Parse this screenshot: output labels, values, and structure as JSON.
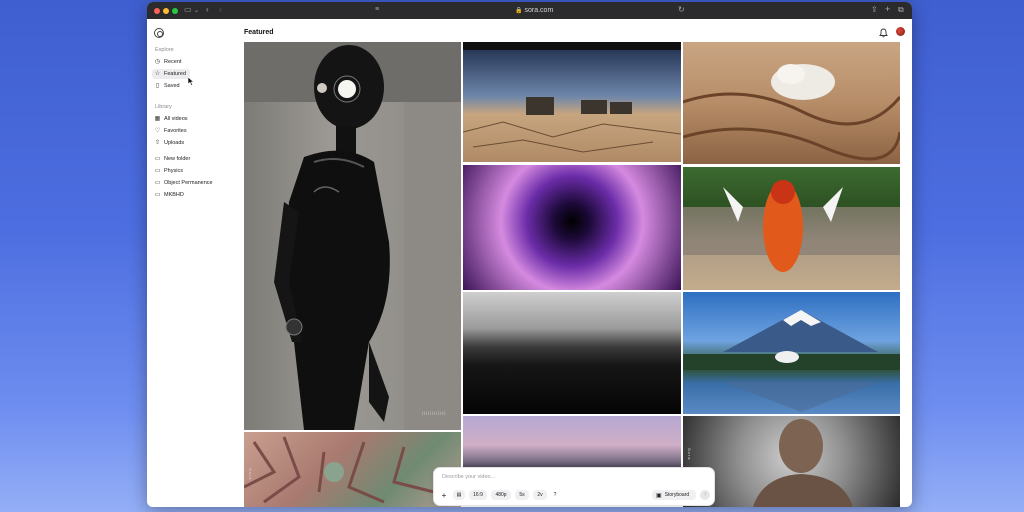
{
  "browser": {
    "url": "sora.com"
  },
  "sidebar": {
    "explore_label": "Explore",
    "explore_items": [
      {
        "label": "Recent",
        "icon": "clock-icon"
      },
      {
        "label": "Featured",
        "icon": "star-icon",
        "active": true
      },
      {
        "label": "Saved",
        "icon": "bookmark-icon"
      }
    ],
    "library_label": "Library",
    "library_items": [
      {
        "label": "All videos",
        "icon": "grid-icon"
      },
      {
        "label": "Favorites",
        "icon": "heart-icon"
      },
      {
        "label": "Uploads",
        "icon": "upload-icon"
      }
    ],
    "folders": [
      {
        "label": "New folder",
        "icon": "folder-icon"
      },
      {
        "label": "Physics",
        "icon": "folder-icon"
      },
      {
        "label": "Object Permanence",
        "icon": "folder-icon"
      },
      {
        "label": "MKBHD",
        "icon": "folder-icon"
      }
    ]
  },
  "main": {
    "title": "Featured",
    "tiles": [
      {
        "name": "robot-video",
        "badge": "||||||||||||"
      },
      {
        "name": "desert-vehicles-video"
      },
      {
        "name": "sand-dunes-cloud-video"
      },
      {
        "name": "purple-vortex-video"
      },
      {
        "name": "parade-dancer-video"
      },
      {
        "name": "ocean-horizon-video"
      },
      {
        "name": "mount-fuji-video"
      },
      {
        "name": "coral-spikes-video",
        "badge": "Sora"
      },
      {
        "name": "sunset-plain-video"
      },
      {
        "name": "bald-man-video",
        "badge": "Sora"
      }
    ]
  },
  "composer": {
    "placeholder": "Describe your video...",
    "aspect": "16:9",
    "resolution": "480p",
    "duration": "5s",
    "variations": "2v",
    "help": "?",
    "storyboard_label": "Storyboard"
  },
  "colors": {
    "accent": "#ececee",
    "desktop": "#4d6ee0"
  }
}
